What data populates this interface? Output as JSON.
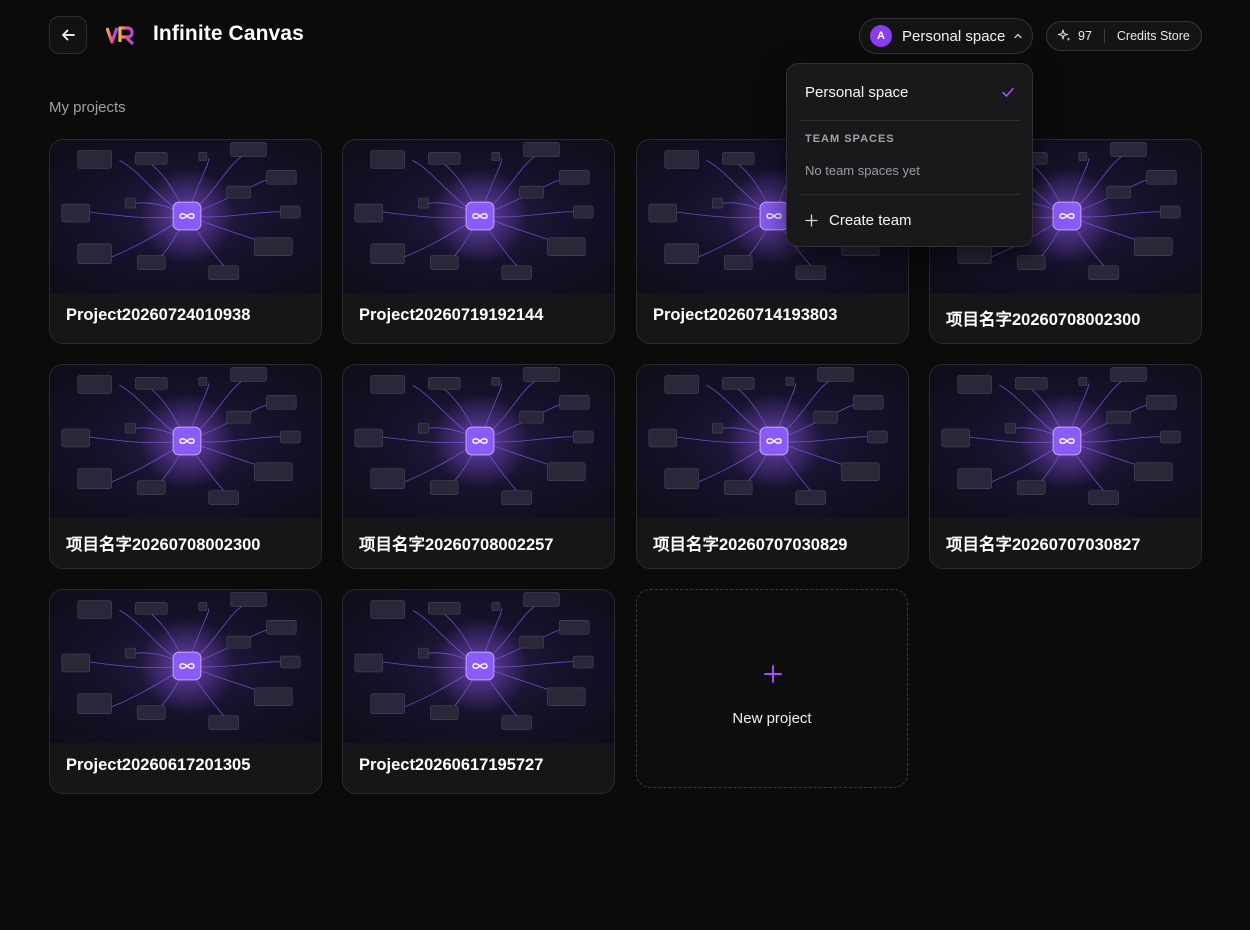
{
  "header": {
    "back_icon": "arrow-left-icon",
    "logo_text": "VR",
    "title": "Infinite Canvas",
    "space": {
      "avatar_letter": "A",
      "label": "Personal space"
    },
    "credits": {
      "icon": "sparkle-icon",
      "count": "97",
      "store_label": "Credits Store"
    }
  },
  "main": {
    "section_title": "My projects",
    "projects": [
      "Project20260724010938",
      "Project20260719192144",
      "Project20260714193803",
      "项目名字20260708002300",
      "项目名字20260708002300",
      "项目名字20260708002257",
      "项目名字20260707030829",
      "项目名字20260707030827",
      "Project20260617201305",
      "Project20260617195727"
    ],
    "new_project_label": "New project"
  },
  "dropdown": {
    "selected": "Personal space",
    "section_label": "TEAM SPACES",
    "empty_text": "No team spaces yet",
    "create_label": "Create team"
  },
  "colors": {
    "accent": "#8b3df2",
    "background": "#0b0b0c",
    "card": "#161618"
  }
}
